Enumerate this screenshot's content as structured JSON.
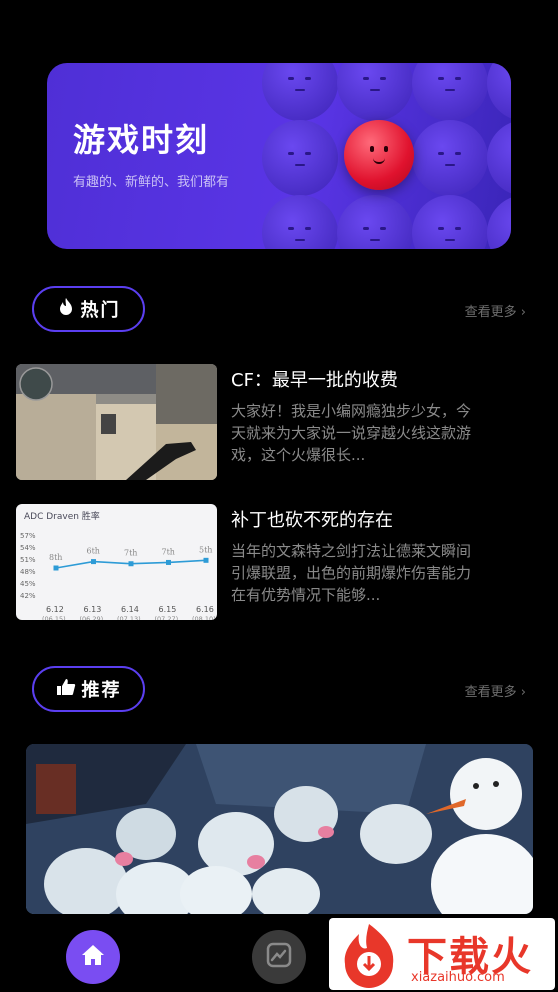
{
  "banner": {
    "title": "游戏时刻",
    "subtitle": "有趣的、新鲜的、我们都有"
  },
  "hot": {
    "label": "热门",
    "more": "查看更多 ›",
    "items": [
      {
        "title": "CF：最早一批的收费",
        "desc": "大家好！我是小编网瘾独步少女，今天就来为大家说一说穿越火线这款游戏，这个火爆很长..."
      },
      {
        "title": "补丁也砍不死的存在",
        "desc": "当年的文森特之剑打法让德莱文瞬间引爆联盟，出色的前期爆炸伤害能力在有优势情况下能够..."
      }
    ]
  },
  "chart_thumb": {
    "title": "ADC Draven 胜率",
    "yticks": [
      "57%",
      "54%",
      "51%",
      "48%",
      "45%",
      "42%"
    ],
    "xticks": [
      "6.12",
      "6.13",
      "6.14",
      "6.15",
      "6.16"
    ],
    "xsub": [
      "(06.15)",
      "(06.29)",
      "(07.13)",
      "(07.27)",
      "(08.10)"
    ],
    "ranks": [
      "8th",
      "6th",
      "7th",
      "7th",
      "5th"
    ]
  },
  "chart_data": {
    "type": "line",
    "title": "ADC Draven 胜率",
    "categories": [
      "6.12",
      "6.13",
      "6.14",
      "6.15",
      "6.16"
    ],
    "values": [
      49.5,
      51.0,
      50.5,
      50.8,
      51.3
    ],
    "ylim": [
      42,
      57
    ]
  },
  "recommend": {
    "label": "推荐",
    "more": "查看更多 ›"
  },
  "watermark": {
    "text": "下载火",
    "url": "xiazaihuo.com"
  },
  "colors": {
    "accent": "#5b3ff0",
    "banner": "#5a35e6",
    "nav_active": "#7a4df2"
  }
}
